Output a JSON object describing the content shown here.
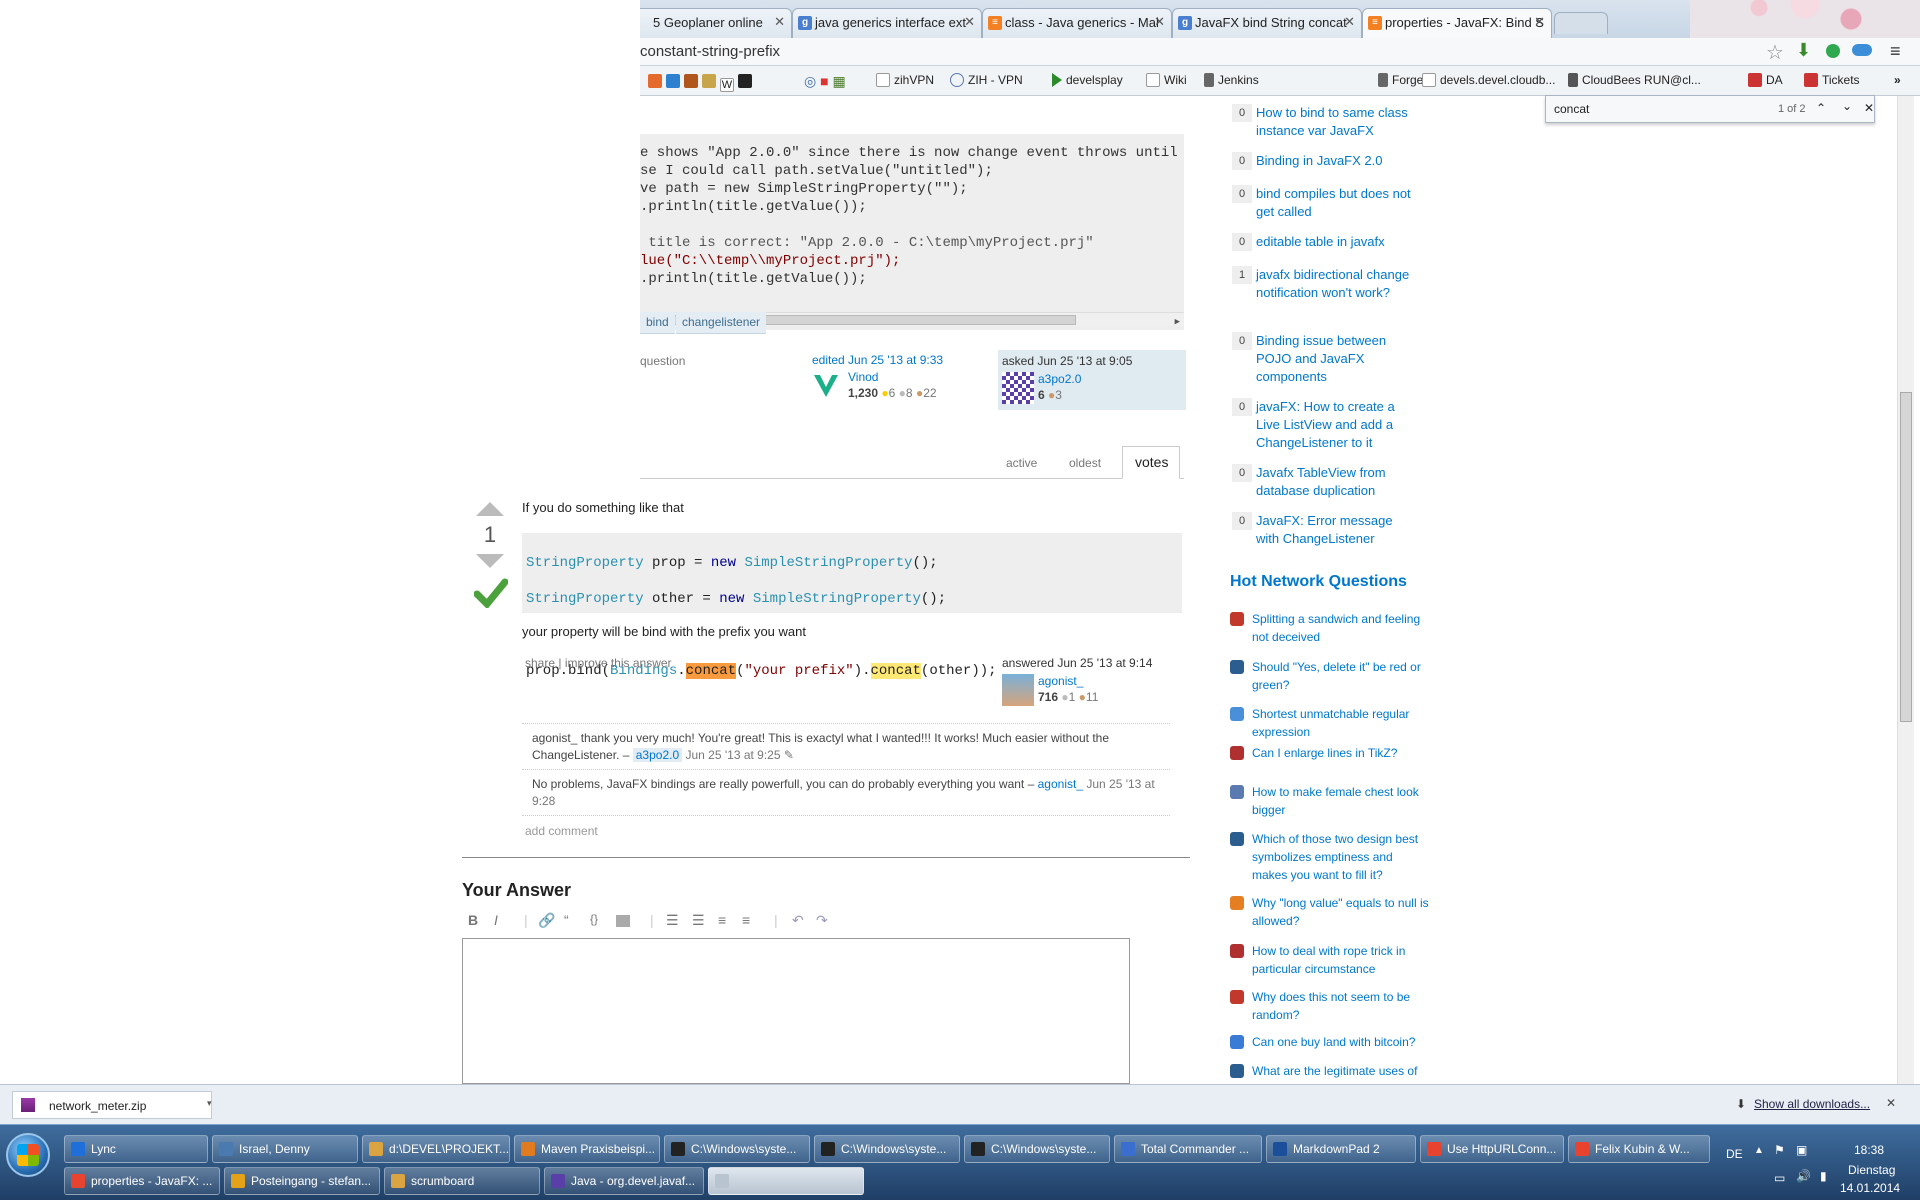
{
  "browser": {
    "tabs": [
      {
        "label": "5 Geoplaner online"
      },
      {
        "label": "java generics interface ext"
      },
      {
        "label": "class - Java generics - Mal"
      },
      {
        "label": "JavaFX bind String concat"
      },
      {
        "label": "properties - JavaFX: Bind S"
      }
    ],
    "url": "constant-string-prefix",
    "bookmarks": [
      "zihVPN",
      "ZIH - VPN",
      "develsplay",
      "Wiki",
      "Jenkins",
      "Forge",
      "devels.devel.cloudb...",
      "CloudBees RUN@cl...",
      "DA",
      "Tickets"
    ],
    "more_bookmarks": "»"
  },
  "find": {
    "query": "concat",
    "count": "1 of 2"
  },
  "question": {
    "code_lines": [
      "e shows \"App 2.0.0\" since there is now change event throws until now",
      "se I could call path.setValue(\"untitled\");",
      "ve path = new SimpleStringProperty(\"\");",
      ".println(title.getValue());",
      "",
      " title is correct: \"App 2.0.0 - C:\\temp\\myProject.prj\"",
      "lue(\"C:\\\\temp\\\\myProject.prj\");",
      ".println(title.getValue());"
    ],
    "tags": [
      "bind",
      "changelistener"
    ],
    "action_link": "question",
    "edited": {
      "label": "edited Jun 25 '13 at 9:33",
      "user": "Vinod",
      "rep": "1,230",
      "gold": "6",
      "silver": "8",
      "bronze": "22"
    },
    "asked": {
      "label": "asked Jun 25 '13 at 9:05",
      "user": "a3po2.0",
      "rep": "6",
      "bronze": "3"
    }
  },
  "sort_tabs": [
    "active",
    "oldest",
    "votes"
  ],
  "answer": {
    "votes": "1",
    "intro": "If you do something like that",
    "code": {
      "line1": {
        "type": "StringProperty",
        "var": " prop = ",
        "kw": "new",
        "ctor": "SimpleStringProperty",
        "end": "();"
      },
      "line2": {
        "type": "StringProperty",
        "var": " other = ",
        "kw": "new",
        "ctor": "SimpleStringProperty",
        "end": "();"
      },
      "line3": {
        "a": "prop.bind(",
        "b": "Bindings",
        "c": ".",
        "d": "concat",
        "e": "(",
        "f": "\"your prefix\"",
        "g": ").",
        "h": "concat",
        "i": "(other));"
      }
    },
    "outro": "your property will be bind with the prefix you want",
    "share": "share",
    "improve": "improve this answer",
    "answered_label": "answered Jun 25 '13 at 9:14",
    "user": "agonist_",
    "rep": "716",
    "silver": "1",
    "bronze": "11",
    "comments": [
      {
        "text": "agonist_ thank you very much! You're great! This is exactyl what I wanted!!! It works! Much easier without the ChangeListener. –",
        "user": "a3po2.0",
        "date": "Jun 25 '13 at 9:25"
      },
      {
        "text": "No problems, JavaFX bindings are really powerfull, you can do probably everything you want –",
        "user": "agonist_",
        "date": "Jun 25 '13 at 9:28"
      }
    ],
    "add_comment": "add comment"
  },
  "your_answer": {
    "heading": "Your Answer"
  },
  "related": [
    {
      "count": "0",
      "title": "How to bind to same class instance var JavaFX"
    },
    {
      "count": "0",
      "title": "Binding in JavaFX 2.0"
    },
    {
      "count": "0",
      "title": "bind compiles but does not get called"
    },
    {
      "count": "0",
      "title": "editable table in javafx"
    },
    {
      "count": "1",
      "title": "javafx bidirectional change notification won't work?"
    },
    {
      "count": "0",
      "title": "Binding issue between POJO and JavaFX components"
    },
    {
      "count": "0",
      "title": "javaFX: How to create a Live ListView and add a ChangeListener to it"
    },
    {
      "count": "0",
      "title": "Javafx TableView from database duplication"
    },
    {
      "count": "0",
      "title": "JavaFX: Error message with ChangeListener"
    }
  ],
  "hot_network": {
    "heading": "Hot Network Questions",
    "items": [
      {
        "title": "Splitting a sandwich and feeling not deceived",
        "icon_color": "#c0392b"
      },
      {
        "title": "Should \"Yes, delete it\" be red or green?",
        "icon_color": "#2c5d8f"
      },
      {
        "title": "Shortest unmatchable regular expression",
        "icon_color": "#4a90d9"
      },
      {
        "title": "Can I enlarge lines in TikZ?",
        "icon_color": "#b03030"
      },
      {
        "title": "How to make female chest look bigger",
        "icon_color": "#5a7ab0"
      },
      {
        "title": "Which of those two design best symbolizes emptiness and makes you want to fill it?",
        "icon_color": "#2c5d8f"
      },
      {
        "title": "Why \"long value\" equals to null is allowed?",
        "icon_color": "#e67e22"
      },
      {
        "title": "How to deal with rope trick in particular circumstance",
        "icon_color": "#b03030"
      },
      {
        "title": "Why does this not seem to be random?",
        "icon_color": "#c0392b"
      },
      {
        "title": "Can one buy land with bitcoin?",
        "icon_color": "#3a7bd5"
      },
      {
        "title": "What are the legitimate uses of the `touch` command?",
        "icon_color": "#2c5d8f"
      }
    ]
  },
  "downloads": {
    "file": "network_meter.zip",
    "show_all": "Show all downloads..."
  },
  "taskbar": {
    "row1": [
      "Lync",
      "Israel, Denny",
      "d:\\DEVEL\\PROJEKT...",
      "Maven Praxisbeispi...",
      "C:\\Windows\\syste...",
      "C:\\Windows\\syste...",
      "C:\\Windows\\syste...",
      "Total Commander ...",
      "MarkdownPad 2",
      "Use HttpURLConn...",
      "Felix Kubin & W..."
    ],
    "row2": [
      "properties - JavaFX: ...",
      "Posteingang - stefan...",
      "scrumboard",
      "Java - org.devel.javaf...",
      ""
    ],
    "lang": "DE",
    "time": "18:38",
    "day": "Dienstag",
    "date": "14.01.2014"
  }
}
